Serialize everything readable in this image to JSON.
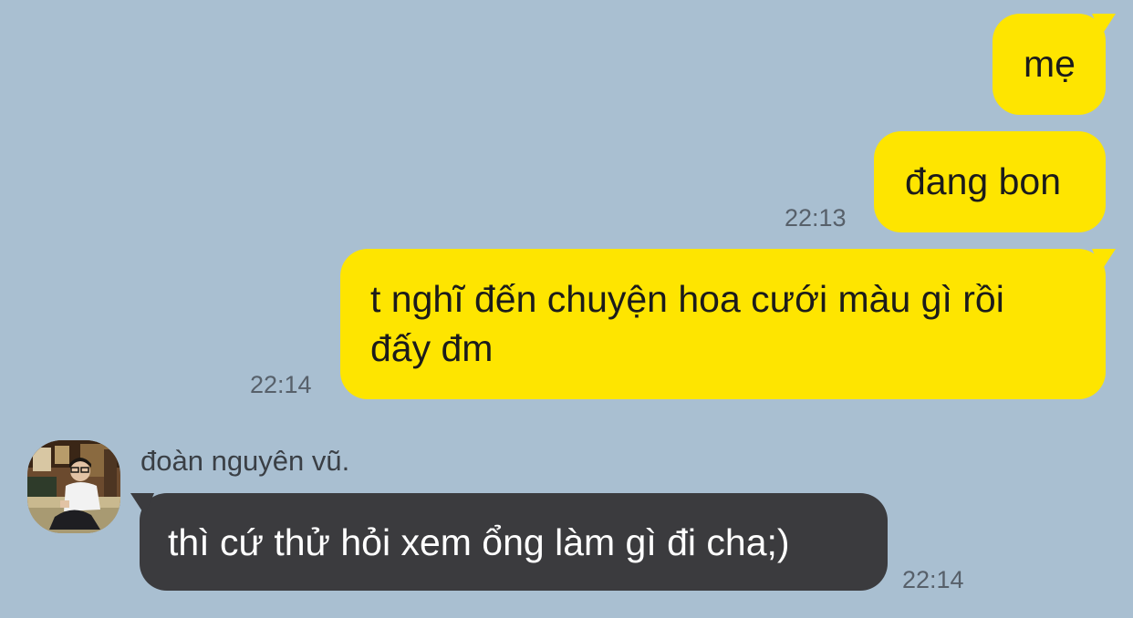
{
  "chat": {
    "messages": [
      {
        "text": "mẹ"
      },
      {
        "text": "đang bon",
        "time": "22:13"
      },
      {
        "line1": "t nghĩ đến chuyện hoa cưới màu gì rồi",
        "line2": "đấy đm",
        "time": "22:14"
      }
    ],
    "incoming": {
      "sender_name": "đoàn nguyên vũ.",
      "text": "thì cứ thử hỏi xem ổng làm gì đi cha;)",
      "time": "22:14"
    }
  },
  "colors": {
    "background": "#a9bfd1",
    "outgoing_bubble": "#fee500",
    "incoming_bubble": "#3b3b3e"
  }
}
